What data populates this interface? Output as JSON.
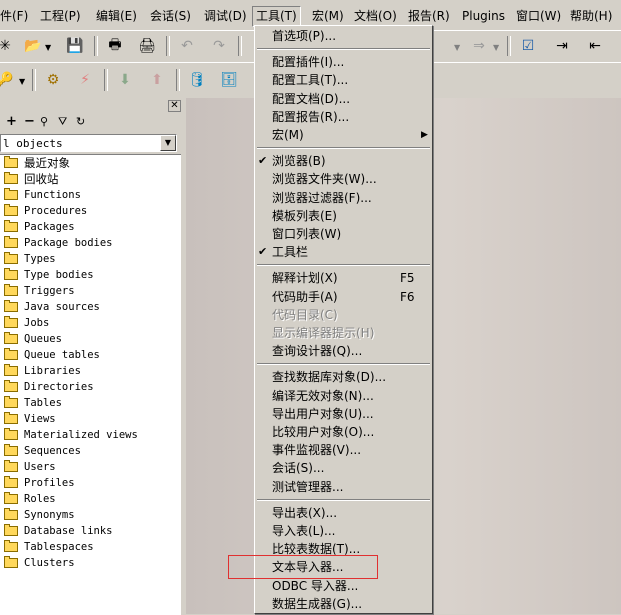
{
  "menubar": [
    {
      "label": "件(F)"
    },
    {
      "label": "工程(P)"
    },
    {
      "label": "编辑(E)"
    },
    {
      "label": "会话(S)"
    },
    {
      "label": "调试(D)"
    },
    {
      "label": "工具(T)"
    },
    {
      "label": "宏(M)"
    },
    {
      "label": "文档(O)"
    },
    {
      "label": "报告(R)"
    },
    {
      "label": "Plugins"
    },
    {
      "label": "窗口(W)"
    },
    {
      "label": "帮助(H)"
    }
  ],
  "object_filter": {
    "selected": "l objects"
  },
  "tree_items": [
    "最近对象",
    "回收站",
    "Functions",
    "Procedures",
    "Packages",
    "Package bodies",
    "Types",
    "Type bodies",
    "Triggers",
    "Java sources",
    "Jobs",
    "Queues",
    "Queue tables",
    "Libraries",
    "Directories",
    "Tables",
    "Views",
    "Materialized views",
    "Sequences",
    "Users",
    "Profiles",
    "Roles",
    "Synonyms",
    "Database links",
    "Tablespaces",
    "Clusters"
  ],
  "tools_menu": {
    "items": [
      {
        "label": "首选项(P)...",
        "shortcut": "",
        "checked": false,
        "disabled": false,
        "submenu": false
      },
      {
        "sep": true
      },
      {
        "label": "配置插件(I)...",
        "shortcut": "",
        "checked": false,
        "disabled": false,
        "submenu": false
      },
      {
        "label": "配置工具(T)...",
        "shortcut": "",
        "checked": false,
        "disabled": false,
        "submenu": false
      },
      {
        "label": "配置文档(D)...",
        "shortcut": "",
        "checked": false,
        "disabled": false,
        "submenu": false
      },
      {
        "label": "配置报告(R)...",
        "shortcut": "",
        "checked": false,
        "disabled": false,
        "submenu": false
      },
      {
        "label": "宏(M)",
        "shortcut": "",
        "checked": false,
        "disabled": false,
        "submenu": true
      },
      {
        "sep": true
      },
      {
        "label": "浏览器(B)",
        "shortcut": "",
        "checked": true,
        "disabled": false,
        "submenu": false
      },
      {
        "label": "浏览器文件夹(W)...",
        "shortcut": "",
        "checked": false,
        "disabled": false,
        "submenu": false
      },
      {
        "label": "浏览器过滤器(F)...",
        "shortcut": "",
        "checked": false,
        "disabled": false,
        "submenu": false
      },
      {
        "label": "模板列表(E)",
        "shortcut": "",
        "checked": false,
        "disabled": false,
        "submenu": false
      },
      {
        "label": "窗口列表(W)",
        "shortcut": "",
        "checked": false,
        "disabled": false,
        "submenu": false
      },
      {
        "label": "工具栏",
        "shortcut": "",
        "checked": true,
        "disabled": false,
        "submenu": false
      },
      {
        "sep": true
      },
      {
        "label": "解释计划(X)",
        "shortcut": "F5",
        "checked": false,
        "disabled": false,
        "submenu": false
      },
      {
        "label": "代码助手(A)",
        "shortcut": "F6",
        "checked": false,
        "disabled": false,
        "submenu": false
      },
      {
        "label": "代码目录(C)",
        "shortcut": "",
        "checked": false,
        "disabled": true,
        "submenu": false
      },
      {
        "label": "显示编译器提示(H)",
        "shortcut": "",
        "checked": false,
        "disabled": true,
        "submenu": false
      },
      {
        "label": "查询设计器(Q)...",
        "shortcut": "",
        "checked": false,
        "disabled": false,
        "submenu": false
      },
      {
        "sep": true
      },
      {
        "label": "查找数据库对象(D)...",
        "shortcut": "",
        "checked": false,
        "disabled": false,
        "submenu": false
      },
      {
        "label": "编译无效对象(N)...",
        "shortcut": "",
        "checked": false,
        "disabled": false,
        "submenu": false
      },
      {
        "label": "导出用户对象(U)...",
        "shortcut": "",
        "checked": false,
        "disabled": false,
        "submenu": false
      },
      {
        "label": "比较用户对象(O)...",
        "shortcut": "",
        "checked": false,
        "disabled": false,
        "submenu": false
      },
      {
        "label": "事件监视器(V)...",
        "shortcut": "",
        "checked": false,
        "disabled": false,
        "submenu": false
      },
      {
        "label": "会话(S)...",
        "shortcut": "",
        "checked": false,
        "disabled": false,
        "submenu": false
      },
      {
        "label": "测试管理器...",
        "shortcut": "",
        "checked": false,
        "disabled": false,
        "submenu": false
      },
      {
        "sep": true
      },
      {
        "label": "导出表(X)...",
        "shortcut": "",
        "checked": false,
        "disabled": false,
        "submenu": false
      },
      {
        "label": "导入表(L)...",
        "shortcut": "",
        "checked": false,
        "disabled": false,
        "submenu": false
      },
      {
        "label": "比较表数据(T)...",
        "shortcut": "",
        "checked": false,
        "disabled": false,
        "submenu": false
      },
      {
        "label": "文本导入器...",
        "shortcut": "",
        "checked": false,
        "disabled": false,
        "submenu": false
      },
      {
        "label": "ODBC 导入器...",
        "shortcut": "",
        "checked": false,
        "disabled": false,
        "submenu": false
      },
      {
        "label": "数据生成器(G)...",
        "shortcut": "",
        "checked": false,
        "disabled": false,
        "submenu": false
      }
    ]
  },
  "annotation": {
    "highlight_color": "#e03030",
    "highlighted_item": "文本导入器..."
  }
}
